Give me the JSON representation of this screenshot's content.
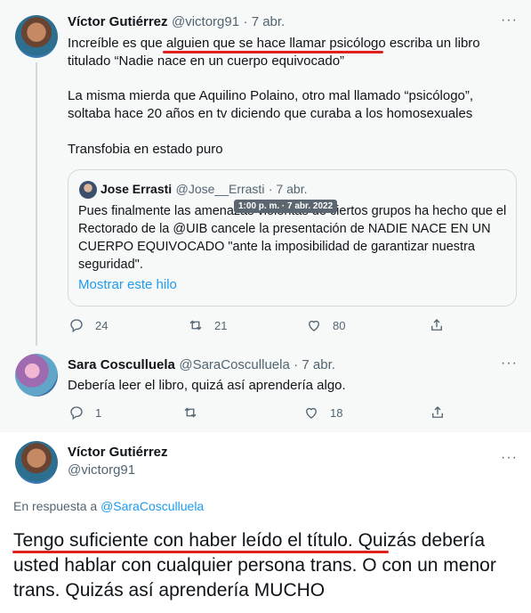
{
  "tweet1": {
    "author_name": "Víctor Gutiérrez",
    "handle": "@victorg91",
    "date": "· 7 abr.",
    "text_part1": "Increíble es que ",
    "text_highlight": "alguien que se hace llamar psicólogo",
    "text_part2": " escriba un libro titulado “Nadie nace en un cuerpo equivocado”",
    "para2": "La misma mierda que Aquilino Polaino, otro mal llamado “psicólogo”, soltaba hace 20 años en tv diciendo que curaba a los homosexuales",
    "para3": "Transfobia en estado puro",
    "actions": {
      "replies": "24",
      "retweets": "21",
      "likes": "80"
    }
  },
  "quote": {
    "author_name": "Jose Errasti",
    "handle": "@Jose__Errasti",
    "date": "· 7 abr.",
    "text": "Pues finalmente las amenazas violentas de ciertos grupos ha hecho que el Rectorado de la @UIB cancele la presentación de NADIE NACE EN UN CUERPO EQUIVOCADO \"ante la imposibilidad de garantizar nuestra seguridad\".",
    "show_thread": "Mostrar este hilo",
    "tooltip": "1:00 p. m. · 7 abr. 2022"
  },
  "tweet2": {
    "author_name": "Sara Cosculluela",
    "handle": "@SaraCosculluela",
    "date": "· 7 abr.",
    "text": "Debería leer el libro, quizá así aprendería algo.",
    "actions": {
      "replies": "1",
      "retweets": "",
      "likes": "18"
    }
  },
  "tweet3": {
    "author_name": "Víctor Gutiérrez",
    "handle": "@victorg91",
    "reply_prefix": "En respuesta a ",
    "reply_to": "@SaraCosculluela",
    "text_highlight": "Tengo suficiente con haber leído el título.",
    "text_rest": " Quizás debería usted hablar con cualquier persona trans. O con un menor trans. Quizás así aprendería MUCHO"
  },
  "ui": {
    "more_glyph": "···",
    "colors": {
      "accent": "#1d9bf0",
      "annotation": "#e0201e",
      "muted": "#536471"
    }
  }
}
